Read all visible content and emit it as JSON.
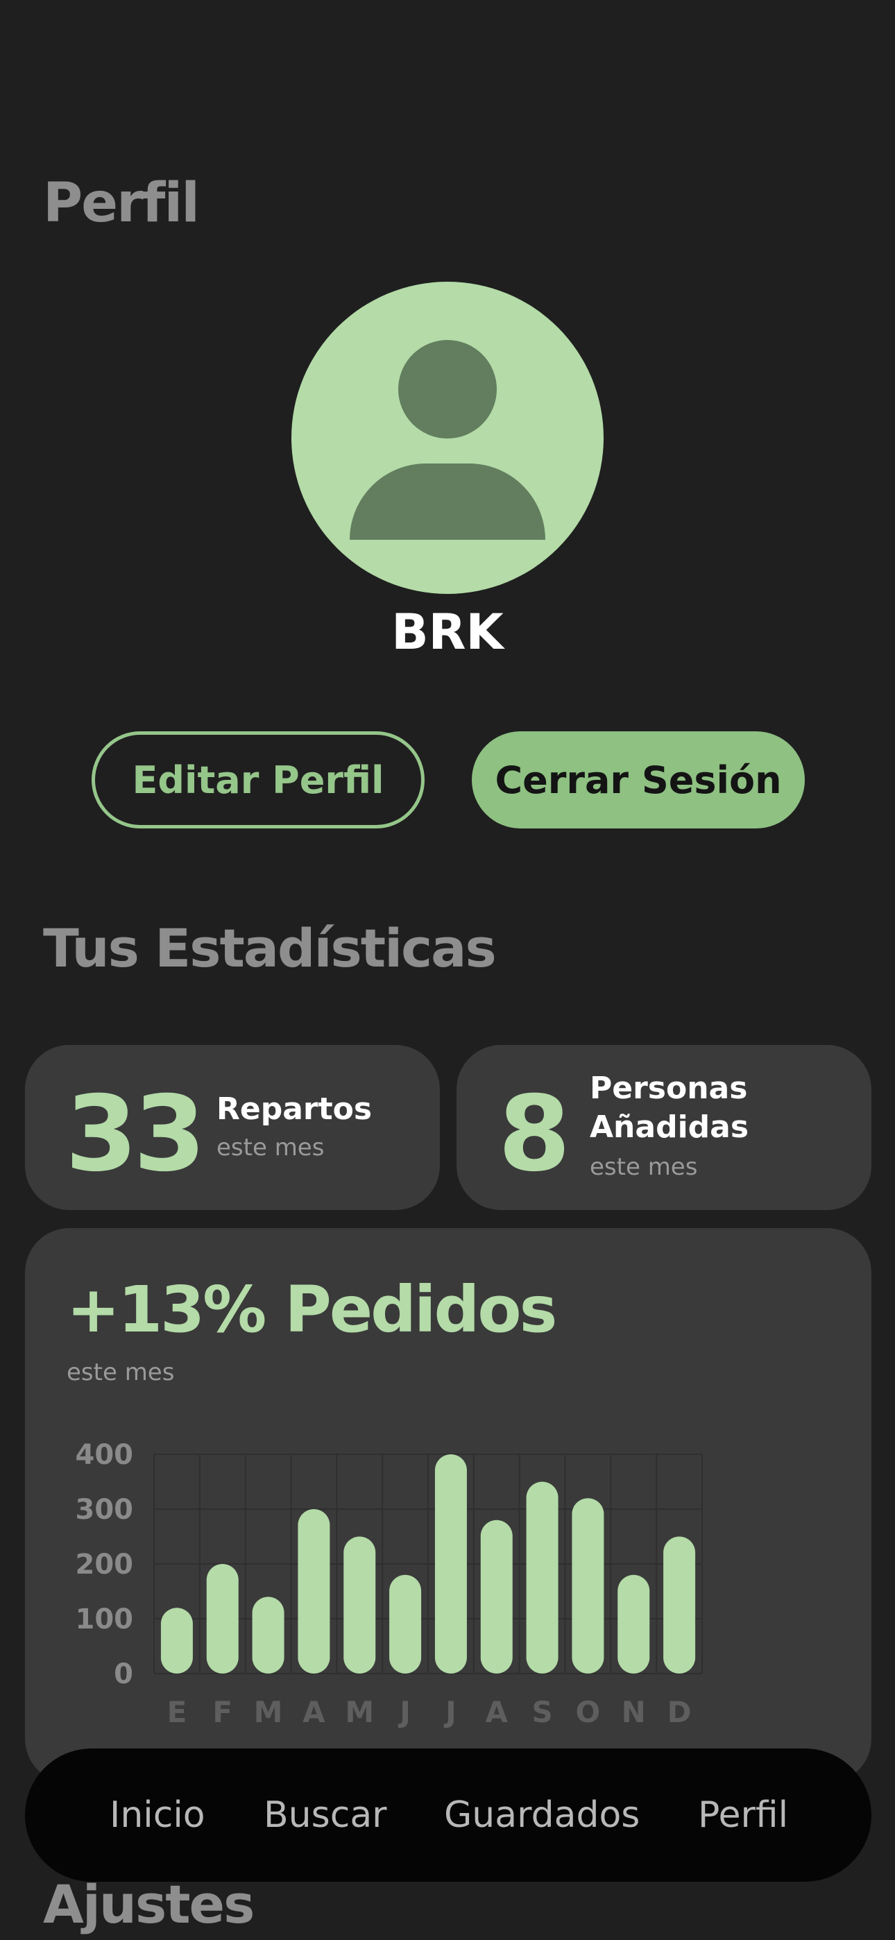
{
  "header": {
    "title": "Perfil"
  },
  "profile": {
    "avatar_icon": "user-avatar-icon",
    "username": "BRK",
    "edit_label": "Editar Perfil",
    "logout_label": "Cerrar Sesión"
  },
  "stats": {
    "title": "Tus Estadísticas",
    "cards": [
      {
        "value": "33",
        "label": "Repartos",
        "sub": "este mes"
      },
      {
        "value": "8",
        "label_line1": "Personas",
        "label_line2": "Añadidas",
        "sub": "este mes"
      }
    ]
  },
  "orders": {
    "headline": "+13% Pedidos",
    "sub": "este mes"
  },
  "chart_data": {
    "type": "bar",
    "categories": [
      "E",
      "F",
      "M",
      "A",
      "M",
      "J",
      "J",
      "A",
      "S",
      "O",
      "N",
      "D"
    ],
    "values": [
      120,
      200,
      140,
      300,
      250,
      180,
      400,
      280,
      350,
      320,
      180,
      250
    ],
    "yticks": [
      0,
      100,
      200,
      300,
      400
    ],
    "ylim": [
      0,
      400
    ],
    "grid": true,
    "bar_color": "#b4dba8"
  },
  "nav": {
    "items": [
      "Inicio",
      "Buscar",
      "Guardados",
      "Perfil"
    ]
  },
  "settings": {
    "title": "Ajustes"
  },
  "colors": {
    "background": "#1f1f1f",
    "accent": "#b4dba8",
    "card": "#3a3a3a",
    "nav": "#050505"
  }
}
